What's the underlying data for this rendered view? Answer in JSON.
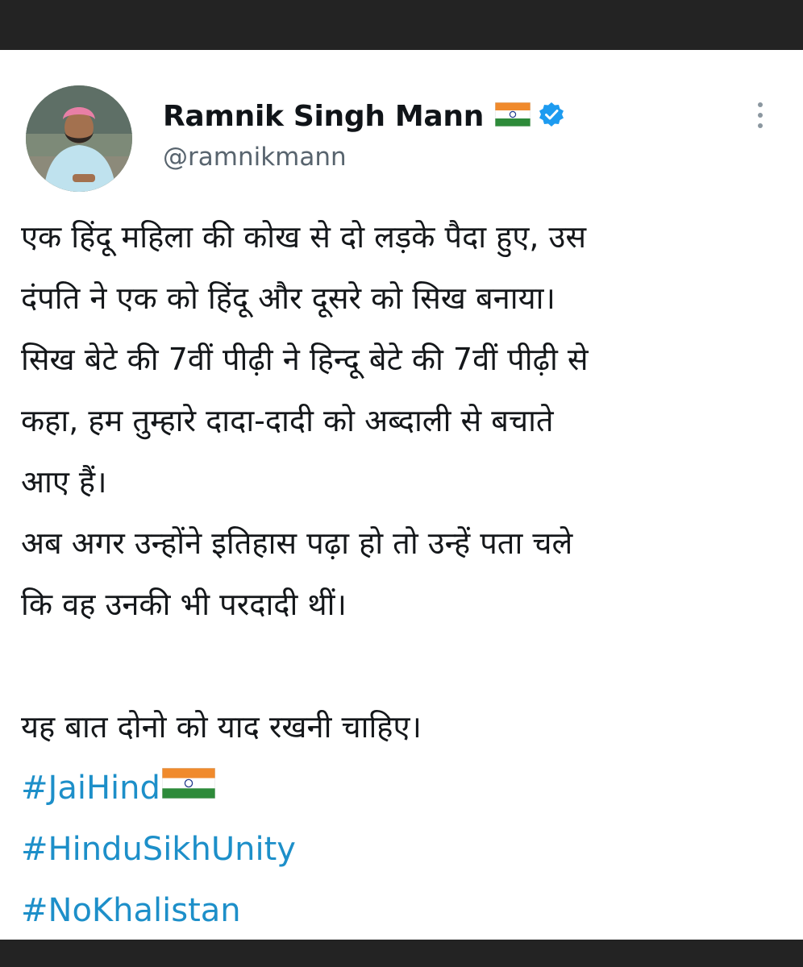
{
  "author": {
    "display_name": "Ramnik Singh Mann",
    "handle": "@ramnikmann"
  },
  "icons": {
    "flag": "india-flag-icon",
    "verified": "verified-badge-icon",
    "more": "more-options-icon"
  },
  "colors": {
    "hashtag": "#1d8fc9",
    "verified": "#1d9bf0",
    "text": "#14171a",
    "handle": "#58646e"
  },
  "tweet": {
    "lines": [
      "एक हिंदू महिला की कोख से दो लड़के पैदा हुए, उस",
      "दंपति ने एक को हिंदू और दूसरे को सिख बनाया।",
      "सिख बेटे की 7वीं पीढ़ी ने हिन्दू बेटे की 7वीं पीढ़ी से",
      "कहा, हम तुम्हारे दादा-दादी को अब्दाली से बचाते",
      "आए हैं।",
      "अब अगर उन्होंने इतिहास पढ़ा हो तो उन्हें पता चले",
      "कि वह उनकी भी परदादी थीं।"
    ],
    "closing_line": "यह बात दोनो को याद रखनी चाहिए।",
    "hashtags": [
      "#JaiHind",
      "#HinduSikhUnity",
      "#NoKhalistan"
    ]
  }
}
